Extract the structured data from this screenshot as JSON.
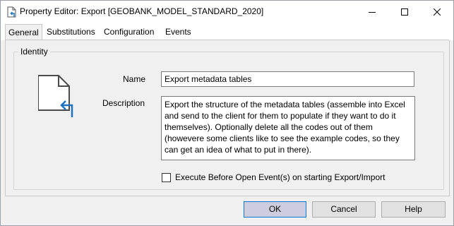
{
  "window": {
    "title": "Property Editor: Export [GEOBANK_MODEL_STANDARD_2020]",
    "controls": [
      "minimize-icon",
      "maximize-icon",
      "close-icon"
    ]
  },
  "tabs": [
    {
      "label": "General",
      "active": true
    },
    {
      "label": "Substitutions",
      "active": false
    },
    {
      "label": "Configuration",
      "active": false
    },
    {
      "label": "Events",
      "active": false
    }
  ],
  "identity": {
    "group_label": "Identity",
    "icon": "export-document-icon",
    "name_label": "Name",
    "name_value": "Export metadata tables",
    "description_label": "Description",
    "description_value": "Export the structure of the metadata tables (assemble into Excel and send to the client for them to populate if they want to do it themselves). Optionally delete all the codes out of them (howevere some clients like to see the example codes, so they can get an idea of what to put in there).",
    "execute_checkbox_label": "Execute Before Open Event(s) on starting Export/Import",
    "execute_checkbox_checked": false
  },
  "buttons": {
    "ok": "OK",
    "cancel": "Cancel",
    "help": "Help"
  },
  "colors": {
    "window_bg": "#f0f0f0",
    "titlebar_bg": "#ffffff",
    "accent": "#0078d7",
    "ok_button_bg": "#cdcde0"
  }
}
